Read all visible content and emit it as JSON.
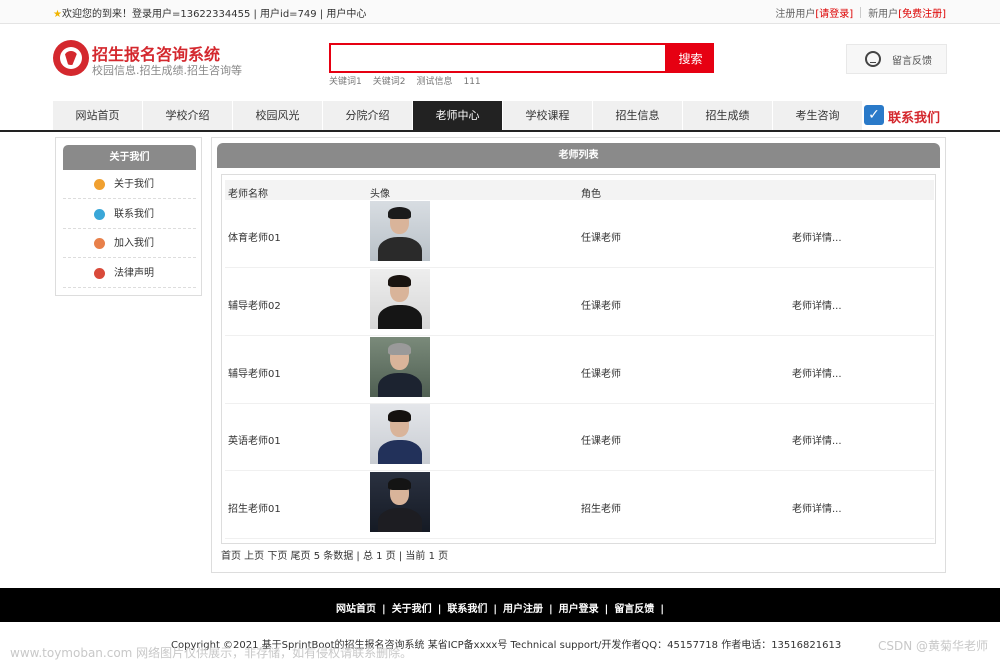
{
  "topbar": {
    "welcome": "欢迎您的到来！登录用户=13622334455 | 用户id=749 | 用户中心",
    "register_user_label": "注册用户",
    "login_link": "[请登录]",
    "new_user_label": "新用户",
    "free_register_link": "[免费注册]"
  },
  "header": {
    "site_title": "招生报名咨询系统",
    "site_subtitle": "校园信息.招生成绩.招生咨询等",
    "search_placeholder": "",
    "search_button": "搜索",
    "keywords": [
      "关键词1",
      "关键词2",
      "测试信息",
      "111"
    ],
    "feedback_button": "留言反馈"
  },
  "nav": {
    "items": [
      "网站首页",
      "学校介绍",
      "校园风光",
      "分院介绍",
      "老师中心",
      "学校课程",
      "招生信息",
      "招生成绩",
      "考生咨询"
    ],
    "active_index": 4,
    "contact": "联系我们"
  },
  "sidebar": {
    "title": "关于我们",
    "items": [
      {
        "label": "关于我们",
        "icon": "info-icon",
        "color": "#f0a030"
      },
      {
        "label": "联系我们",
        "icon": "clipboard-icon",
        "color": "#3aa7d8"
      },
      {
        "label": "加入我们",
        "icon": "lock-icon",
        "color": "#e8804a"
      },
      {
        "label": "法律声明",
        "icon": "power-icon",
        "color": "#d94a3a"
      }
    ]
  },
  "main": {
    "title": "老师列表",
    "columns": [
      "老师名称",
      "头像",
      "角色",
      ""
    ],
    "rows": [
      {
        "name": "体育老师01",
        "role": "任课老师",
        "detail": "老师详情..."
      },
      {
        "name": "辅导老师02",
        "role": "任课老师",
        "detail": "老师详情..."
      },
      {
        "name": "辅导老师01",
        "role": "任课老师",
        "detail": "老师详情..."
      },
      {
        "name": "英语老师01",
        "role": "任课老师",
        "detail": "老师详情..."
      },
      {
        "name": "招生老师01",
        "role": "招生老师",
        "detail": "老师详情..."
      }
    ],
    "pager": "首页 上页 下页 尾页 5 条数据 | 总 1 页 | 当前 1 页"
  },
  "footer": {
    "links": [
      "网站首页",
      "关于我们",
      "联系我们",
      "用户注册",
      "用户登录",
      "留言反馈"
    ],
    "copyright": "Copyright ©2021 基于SprintBoot的招生报名咨询系统   某省ICP备xxxx号   Technical support/开发作者QQ：45157718   作者电话：13516821613"
  },
  "watermark": {
    "left": "www.toymoban.com 网络图片仅供展示，非存储，如有侵权请联系删除。",
    "right": "CSDN @黄菊华老师"
  },
  "colors": {
    "accent": "#e60012",
    "brand": "#d4282e",
    "nav_active": "#222222",
    "panel_header": "#8a8a8a"
  }
}
